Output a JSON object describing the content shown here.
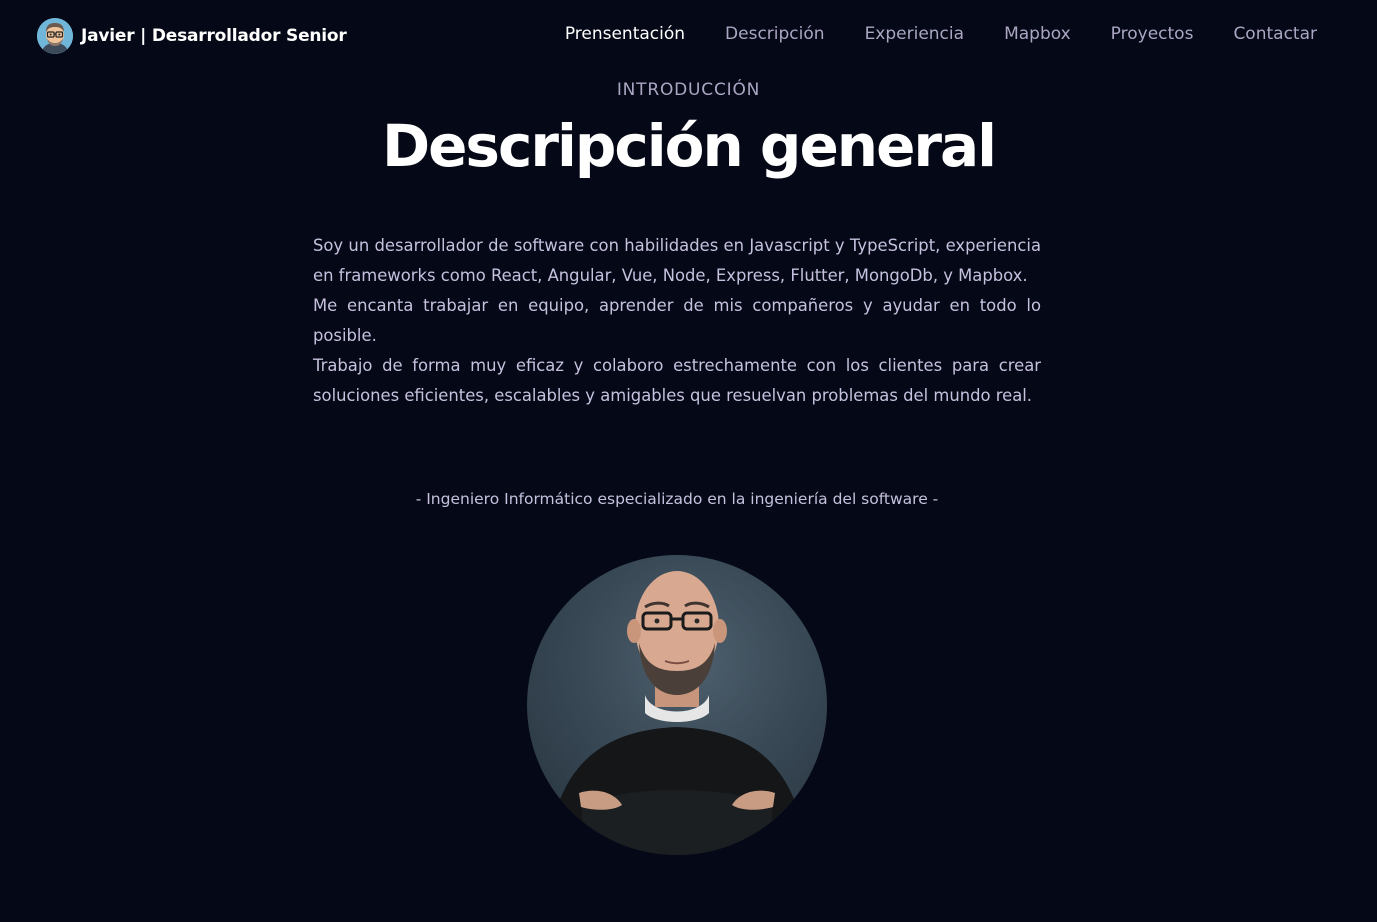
{
  "navbar": {
    "brand": {
      "name": "Javier",
      "role": "| Desarrollador Senior",
      "avatar_icon": "cartoon-avatar-icon"
    },
    "links": [
      {
        "label": "Prensentación",
        "active": true
      },
      {
        "label": "Descripción",
        "active": false
      },
      {
        "label": "Experiencia",
        "active": false
      },
      {
        "label": "Mapbox",
        "active": false
      },
      {
        "label": "Proyectos",
        "active": false
      },
      {
        "label": "Contactar",
        "active": false
      }
    ]
  },
  "overview": {
    "subtitle": "Introducción",
    "title": "Descripción general",
    "paragraphs": [
      "Soy un desarrollador de software con habilidades en Javascript y TypeScript, experiencia en frameworks como React, Angular, Vue, Node, Express, Flutter, MongoDb, y Mapbox.",
      "Me encanta trabajar en equipo, aprender de mis compañeros y ayudar en todo lo posible.",
      "Trabajo de forma muy eficaz y colaboro estrechamente con los clientes para crear soluciones eficientes, escalables y amigables que resuelvan problemas del mundo real."
    ],
    "tagline": "- Ingeniero Informático especializado en la ingeniería del software -",
    "portrait": "profile-photo"
  },
  "colors": {
    "background": "#050816",
    "secondary_text": "#aaa6c3",
    "body_text": "#c5c1de",
    "white": "#ffffff"
  }
}
